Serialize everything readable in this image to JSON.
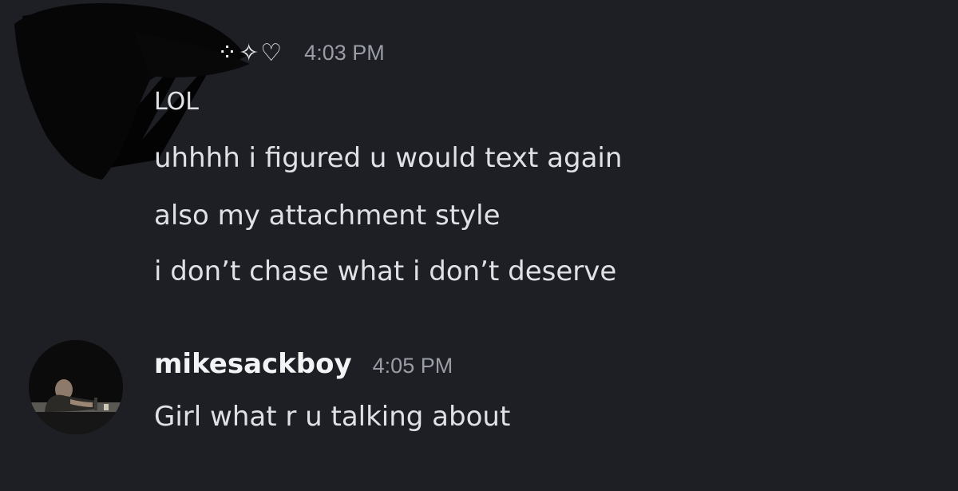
{
  "messages": [
    {
      "author_decoration": "⁘✧♡",
      "time": "4:03 PM",
      "lines": [
        "LOL",
        "uhhhh i figured u would text again",
        "also my attachment style",
        "i don’t chase what i don’t deserve"
      ]
    },
    {
      "username": "mikesackboy",
      "time": "4:05 PM",
      "lines": [
        "Girl what r u talking about"
      ]
    }
  ],
  "colors": {
    "background": "#1e1f24",
    "message_text": "#dfe1e5",
    "timestamp": "#9a9da6",
    "username": "#f2f3f5"
  },
  "icons": {
    "redaction": "redaction-scribble",
    "avatar": "user-avatar-photo"
  }
}
